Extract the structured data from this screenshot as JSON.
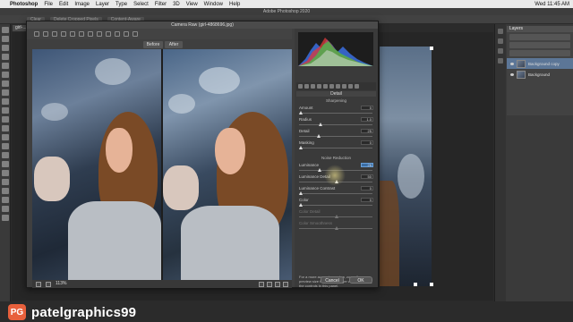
{
  "menubar": {
    "app": "Photoshop",
    "items": [
      "File",
      "Edit",
      "Image",
      "Layer",
      "Type",
      "Select",
      "Filter",
      "3D",
      "View",
      "Window",
      "Help"
    ],
    "clock": "Wed 11:45 AM"
  },
  "window_title": "Adobe Photoshop 2020",
  "options_bar": {
    "chips": [
      "Clear",
      "Delete Cropped Pixels",
      "Content-Aware"
    ]
  },
  "document_tab": "girl-...",
  "camera_raw": {
    "title": "Camera Raw (girl-4868696.jpg)",
    "before_label": "Before",
    "after_label": "After",
    "zoom": "113%",
    "panel_title": "Detail",
    "sharpening": {
      "heading": "Sharpening",
      "amount": {
        "label": "Amount",
        "value": "0",
        "fraction": 0.0
      },
      "radius": {
        "label": "Radius",
        "value": "1.0",
        "fraction": 0.27
      },
      "detail": {
        "label": "Detail",
        "value": "25",
        "fraction": 0.25
      },
      "masking": {
        "label": "Masking",
        "value": "0",
        "fraction": 0.0
      }
    },
    "noise_reduction": {
      "heading": "Noise Reduction",
      "luminance": {
        "label": "Luminance",
        "value": "26",
        "fraction": 0.26
      },
      "luminance_detail": {
        "label": "Luminance Detail",
        "value": "50",
        "fraction": 0.5
      },
      "luminance_contrast": {
        "label": "Luminance Contrast",
        "value": "0",
        "fraction": 0.0
      },
      "color": {
        "label": "Color",
        "value": "0",
        "fraction": 0.0
      },
      "color_detail": {
        "label": "Color Detail",
        "value": "",
        "fraction": 0.5
      },
      "color_smoothness": {
        "label": "Color Smoothness",
        "value": "",
        "fraction": 0.5
      }
    },
    "note": "For a more accurate preview, zoom the preview size to 100% or larger when adjusting the controls in this panel.",
    "cancel_label": "Cancel",
    "ok_label": "OK"
  },
  "layers_panel": {
    "title": "Layers",
    "layers": [
      {
        "name": "Background copy",
        "selected": true
      },
      {
        "name": "Background",
        "selected": false
      }
    ]
  },
  "status_bar": "25.47%",
  "branding": {
    "logo": "PG",
    "name": "patelgraphics99"
  }
}
